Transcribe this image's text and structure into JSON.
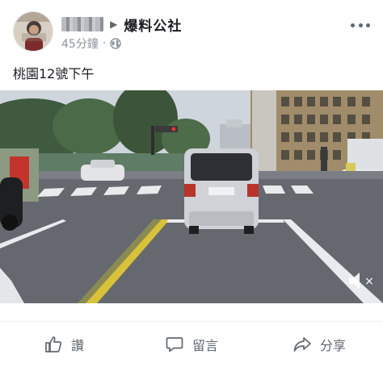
{
  "post": {
    "author": "",
    "group": "爆料公社",
    "time": "45分鐘",
    "meta_dot": "·",
    "text": "桃園12號下午"
  },
  "video": {
    "muted_label": "×",
    "signs": {
      "camera": "",
      "store": ""
    }
  },
  "actions": [
    {
      "label": "讚",
      "icon": "like-icon"
    },
    {
      "label": "留言",
      "icon": "comment-icon"
    },
    {
      "label": "分享",
      "icon": "share-icon"
    }
  ],
  "colors": {
    "text": "#1c1e21",
    "secondary": "#606770",
    "meta": "#8d949e"
  }
}
